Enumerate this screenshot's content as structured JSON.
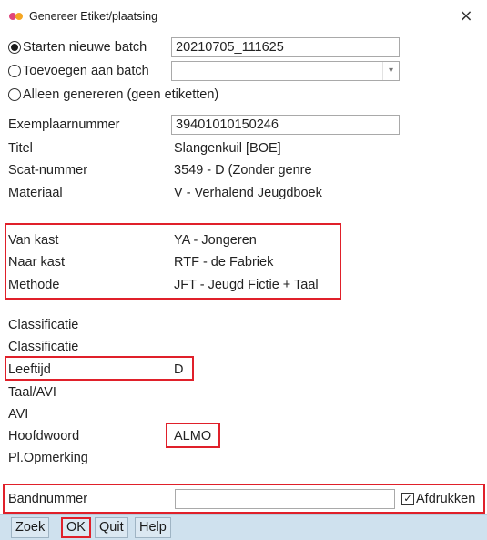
{
  "window": {
    "title": "Genereer Etiket/plaatsing",
    "close": "×"
  },
  "options": {
    "new_batch_label": "Starten nieuwe batch",
    "new_batch_value": "20210705_111625",
    "add_batch_label": "Toevoegen aan batch",
    "add_batch_value": "",
    "only_generate_label": "Alleen genereren (geen etiketten)"
  },
  "fields": {
    "exemplaarnummer": {
      "label": "Exemplaarnummer",
      "value": "39401010150246"
    },
    "titel": {
      "label": "Titel",
      "value": "Slangenkuil [BOE]"
    },
    "scat": {
      "label": "Scat-nummer",
      "value": "3549 - D (Zonder genre"
    },
    "materiaal": {
      "label": "Materiaal",
      "value": "V - Verhalend Jeugdboek"
    },
    "van_kast": {
      "label": "Van kast",
      "value": "YA - Jongeren"
    },
    "naar_kast": {
      "label": "Naar kast",
      "value": "RTF - de Fabriek"
    },
    "methode": {
      "label": "Methode",
      "value": "JFT - Jeugd Fictie + Taal"
    },
    "classificatie1": {
      "label": "Classificatie",
      "value": ""
    },
    "classificatie2": {
      "label": "Classificatie",
      "value": ""
    },
    "leeftijd": {
      "label": "Leeftijd",
      "value": "D"
    },
    "taal_avi": {
      "label": "Taal/AVI",
      "value": ""
    },
    "avi": {
      "label": "AVI",
      "value": ""
    },
    "hoofdwoord": {
      "label": "Hoofdwoord",
      "value": "ALMO"
    },
    "pl_opmerking": {
      "label": "Pl.Opmerking",
      "value": ""
    },
    "bandnummer": {
      "label": "Bandnummer",
      "value": ""
    }
  },
  "print_checkbox": {
    "label": "Afdrukken",
    "checked": true,
    "mark": "✓"
  },
  "toolbar": {
    "zoek": "Zoek",
    "ok": "OK",
    "quit": "Quit",
    "help": "Help"
  },
  "colors": {
    "highlight": "#e0202a",
    "toolbar_bg": "#cfe1ee"
  }
}
